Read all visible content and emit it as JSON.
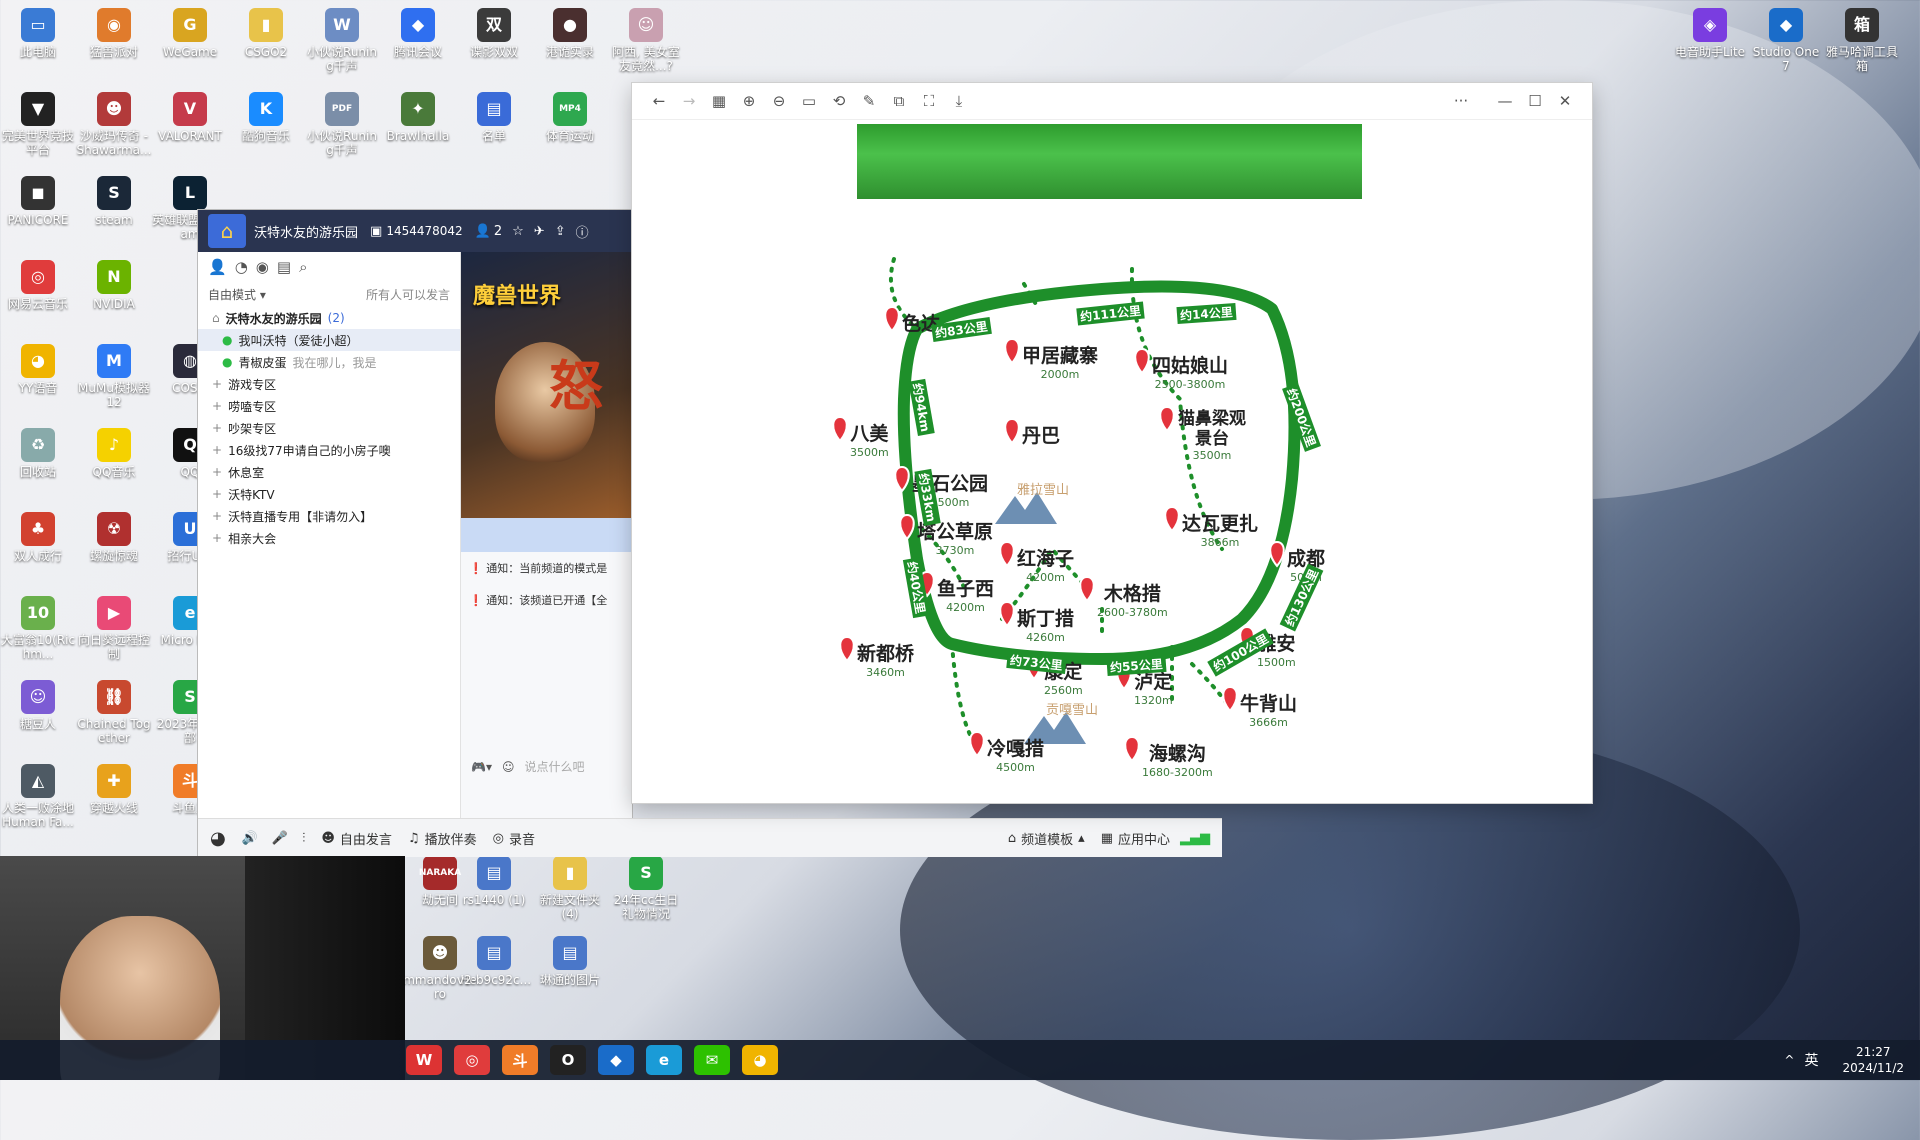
{
  "desktop_icons": [
    {
      "label": "此电脑",
      "color": "#3a7bd5",
      "glyph": "▭"
    },
    {
      "label": "猛兽派对",
      "color": "#e07b2c",
      "glyph": "◉"
    },
    {
      "label": "WeGame",
      "color": "#d9a520",
      "glyph": "G"
    },
    {
      "label": "CSGO2",
      "color": "#e8c34a",
      "glyph": "▮"
    },
    {
      "label": "小伙说Runing千声",
      "color": "#6d8dc4",
      "glyph": "W"
    },
    {
      "label": "腾讯会议",
      "color": "#2f6ff0",
      "glyph": "◆"
    },
    {
      "label": "谍影双双",
      "color": "#3b3b3b",
      "glyph": "双"
    },
    {
      "label": "港诡实录",
      "color": "#4a2f2f",
      "glyph": "●"
    },
    {
      "label": "阿西, 美女室友竟然...?",
      "color": "#c9a0b0",
      "glyph": "☺"
    },
    {
      "label": "完美世界竞技平台",
      "color": "#222",
      "glyph": "▼"
    },
    {
      "label": "沙威玛传奇 - Shawarma...",
      "color": "#b23a3a",
      "glyph": "☻"
    },
    {
      "label": "VALORANT",
      "color": "#c53b4b",
      "glyph": "V"
    },
    {
      "label": "酷狗音乐",
      "color": "#1a8cff",
      "glyph": "K"
    },
    {
      "label": "小伙说Runing千声",
      "color": "#7b8ea8",
      "glyph": "PDF"
    },
    {
      "label": "Brawlhalla",
      "color": "#4a7a3a",
      "glyph": "✦"
    },
    {
      "label": "名单",
      "color": "#3a6bd8",
      "glyph": "▤"
    },
    {
      "label": "体育运动",
      "color": "#2ea84f",
      "glyph": "MP4"
    },
    {
      "label": "PANICORE",
      "color": "#333",
      "glyph": "◼"
    },
    {
      "label": "steam",
      "color": "#1b2838",
      "glyph": "S"
    },
    {
      "label": "英雄联盟WeGam",
      "color": "#0c2233",
      "glyph": "L"
    },
    {
      "label": "网易云音乐",
      "color": "#e03c3c",
      "glyph": "◎"
    },
    {
      "label": "NVIDIA",
      "color": "#6bb300",
      "glyph": "N"
    },
    {
      "label": "YY语音",
      "color": "#f0b400",
      "glyph": "◕"
    },
    {
      "label": "MuMu模拟器12",
      "color": "#2f7bf5",
      "glyph": "M"
    },
    {
      "label": "COSM",
      "color": "#2a2a3a",
      "glyph": "◍"
    },
    {
      "label": "回收站",
      "color": "#8aa",
      "glyph": "♻"
    },
    {
      "label": "QQ音乐",
      "color": "#f5d100",
      "glyph": "♪"
    },
    {
      "label": "QQ",
      "color": "#111",
      "glyph": "Q"
    },
    {
      "label": "双人成行",
      "color": "#d2412f",
      "glyph": "♣"
    },
    {
      "label": "螺旋惊魂",
      "color": "#b0302f",
      "glyph": "☢"
    },
    {
      "label": "招行U-B",
      "color": "#2b6fd8",
      "glyph": "U"
    },
    {
      "label": "大富翁10(Richm...",
      "color": "#6ab04c",
      "glyph": "10"
    },
    {
      "label": "向日葵远程控制",
      "color": "#e94a76",
      "glyph": "▶"
    },
    {
      "label": "Micro Edg",
      "color": "#1a9bd7",
      "glyph": "e"
    },
    {
      "label": "糖豆人",
      "color": "#7c5cd4",
      "glyph": "☺"
    },
    {
      "label": "Chained Together",
      "color": "#c8492f",
      "glyph": "⛓"
    },
    {
      "label": "2023年俱乐部",
      "color": "#28a745",
      "glyph": "S"
    },
    {
      "label": "人类一败涂地Human Fa...",
      "color": "#4e5a64",
      "glyph": "◭"
    },
    {
      "label": "穿越火线",
      "color": "#e8a21c",
      "glyph": "✚"
    },
    {
      "label": "斗鱼直",
      "color": "#f07c28",
      "glyph": "斗"
    }
  ],
  "desktop_icons_right": [
    {
      "label": "电音助手Lite",
      "color": "#7a3de0",
      "glyph": "◈"
    },
    {
      "label": "Studio One 7",
      "color": "#1a6cc9",
      "glyph": "◆"
    },
    {
      "label": "雅马哈调工具箱",
      "color": "#333",
      "glyph": "箱"
    }
  ],
  "desktop_icons_mid": [
    {
      "label": "劫无间",
      "color": "#a52a2a",
      "glyph": "NARAKA"
    },
    {
      "label": "rs1440 (1)",
      "color": "#4a77c9",
      "glyph": "▤"
    },
    {
      "label": "新建文件夹 (4)",
      "color": "#e8c34a",
      "glyph": "▮"
    },
    {
      "label": "24年cc生日礼物情况",
      "color": "#28a745",
      "glyph": "S"
    },
    {
      "label": "mmando Hero",
      "color": "#6b5a3a",
      "glyph": "☻"
    },
    {
      "label": "v2-b9c92c...",
      "color": "#4a77c9",
      "glyph": "▤"
    },
    {
      "label": "琳通的图片",
      "color": "#4a77c9",
      "glyph": "▤"
    }
  ],
  "viewer": {
    "toolbar_icons": [
      "back-arrow-icon",
      "forward-arrow-icon",
      "grid-icon",
      "zoom-in-icon",
      "zoom-out-icon",
      "fit-icon",
      "rotate-icon",
      "edit-icon",
      "compare-icon",
      "fullscreen-icon",
      "save-icon"
    ],
    "more": "···",
    "min": "—",
    "max": "☐",
    "close": "✕"
  },
  "map": {
    "stops": [
      {
        "name": "色达",
        "alt": ""
      },
      {
        "name": "甲居藏寨",
        "alt": "2000m"
      },
      {
        "name": "四姑娘山",
        "alt": "2500-3800m"
      },
      {
        "name": "八美",
        "alt": "3500m"
      },
      {
        "name": "丹巴",
        "alt": ""
      },
      {
        "name": "猫鼻梁观景台",
        "alt": "3500m"
      },
      {
        "name": "墨石公园",
        "alt": "3500m"
      },
      {
        "name": "雅拉雪山",
        "alt": ""
      },
      {
        "name": "达瓦更扎",
        "alt": "3866m"
      },
      {
        "name": "塔公草原",
        "alt": "3730m"
      },
      {
        "name": "红海子",
        "alt": "4200m"
      },
      {
        "name": "成都",
        "alt": "500m"
      },
      {
        "name": "鱼子西",
        "alt": "4200m"
      },
      {
        "name": "木格措",
        "alt": "2600-3780m"
      },
      {
        "name": "斯丁措",
        "alt": "4260m"
      },
      {
        "name": "新都桥",
        "alt": "3460m"
      },
      {
        "name": "雅安",
        "alt": "1500m"
      },
      {
        "name": "康定",
        "alt": "2560m"
      },
      {
        "name": "泸定",
        "alt": "1320m"
      },
      {
        "name": "牛背山",
        "alt": "3666m"
      },
      {
        "name": "贡嘎雪山",
        "alt": ""
      },
      {
        "name": "冷嘎措",
        "alt": "4500m"
      },
      {
        "name": "海螺沟",
        "alt": "1680-3200m"
      }
    ],
    "distances": [
      "约83公里",
      "约111公里",
      "约14公里",
      "约200公里",
      "约130公里",
      "约100公里",
      "约55公里",
      "约73公里",
      "约40公里",
      "约94km",
      "约33km"
    ]
  },
  "yy": {
    "channel_name": "沃特水友的游乐园",
    "channel_id": "1454478042",
    "user_count": "2",
    "mode": "自由模式",
    "permission": "所有人可以发言",
    "banner": "魔兽世界",
    "tree": [
      {
        "label": "沃特水友的游乐园",
        "extra": "(2)",
        "bold": true
      },
      {
        "label": "我叫沃特（爱徒小超）",
        "extra": "",
        "bold": false,
        "user": true,
        "hl": true
      },
      {
        "label": "青椒皮蛋",
        "extra": "我在哪儿，我是",
        "bold": false,
        "user": true
      },
      {
        "label": "游戏专区",
        "extra": ""
      },
      {
        "label": "唠嗑专区",
        "extra": ""
      },
      {
        "label": "吵架专区",
        "extra": ""
      },
      {
        "label": "16级找77申请自己的小房子噢",
        "extra": ""
      },
      {
        "label": "休息室",
        "extra": ""
      },
      {
        "label": "沃特KTV",
        "extra": ""
      },
      {
        "label": "沃特直播专用【非请勿入】",
        "extra": ""
      },
      {
        "label": "相亲大会",
        "extra": ""
      }
    ],
    "notices": [
      "通知：当前频道的模式是",
      "通知：该频道已开通【全"
    ],
    "input_placeholder": "说点什么吧",
    "bottom": {
      "free_speak": "自由发言",
      "play_music": "播放伴奏",
      "record": "录音",
      "template": "频道模板",
      "app_center": "应用中心"
    }
  },
  "taskbar": {
    "icons": [
      {
        "name": "wps-icon",
        "color": "#d33",
        "glyph": "W"
      },
      {
        "name": "netease-music-icon",
        "color": "#e03c3c",
        "glyph": "◎"
      },
      {
        "name": "douyu-icon",
        "color": "#f07c28",
        "glyph": "斗"
      },
      {
        "name": "obs-icon",
        "color": "#222",
        "glyph": "O"
      },
      {
        "name": "studio-one-icon",
        "color": "#1a6cc9",
        "glyph": "◆"
      },
      {
        "name": "edge-icon",
        "color": "#1a9bd7",
        "glyph": "e"
      },
      {
        "name": "wechat-icon",
        "color": "#2dc100",
        "glyph": "✉"
      },
      {
        "name": "yy-icon",
        "color": "#f0b400",
        "glyph": "◕"
      }
    ],
    "tray_lang": "英",
    "tray_arrow": "^",
    "time": "21:27",
    "date": "2024/11/2"
  }
}
